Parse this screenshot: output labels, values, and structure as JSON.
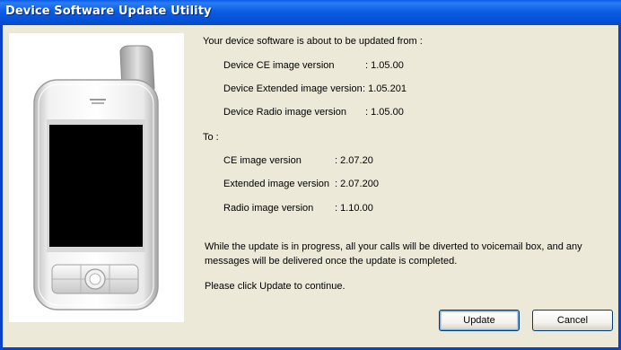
{
  "window": {
    "title": "Device Software Update Utility"
  },
  "intro": "Your device software is about to be updated from :",
  "current_versions": [
    {
      "label": "Device CE image version",
      "value": ": 1.05.00"
    },
    {
      "label": "Device Extended image version",
      "value": ": 1.05.201"
    },
    {
      "label": "Device Radio image version",
      "value": ": 1.05.00"
    }
  ],
  "to_label": "To :",
  "new_versions": [
    {
      "label": "CE image version",
      "value": ": 2.07.20"
    },
    {
      "label": "Extended image version",
      "value": ": 2.07.200"
    },
    {
      "label": "Radio image version",
      "value": ": 1.10.00"
    }
  ],
  "notice_line1": "While the update is in progress, all your calls will be diverted to voicemail box, and any",
  "notice_line2": "messages will be delivered once the update is completed.",
  "prompt": "Please click Update to continue.",
  "buttons": {
    "update": "Update",
    "cancel": "Cancel"
  },
  "colors": {
    "titlebar": "#0A5BE8",
    "window_bg": "#ECE9D8",
    "screen": "#000000"
  }
}
